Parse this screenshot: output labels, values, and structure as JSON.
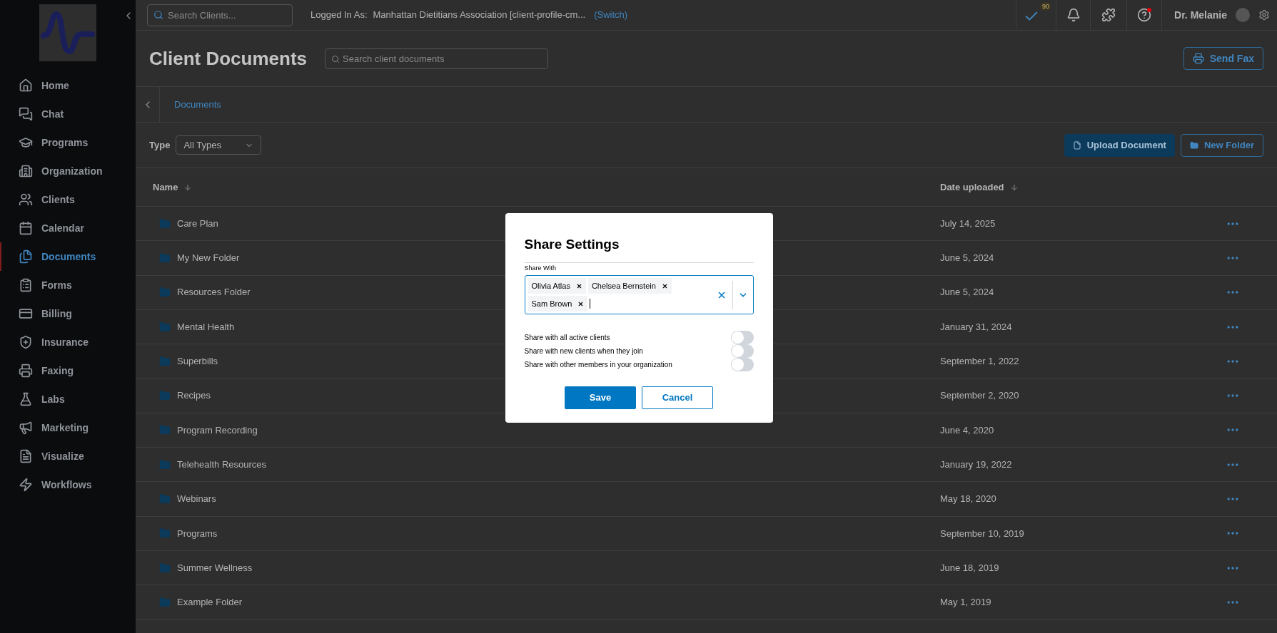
{
  "topbar": {
    "search": {
      "placeholder": "Search Clients..."
    },
    "logged_in_label": "Logged In As:",
    "account": "Manhattan Dietitians Association [client-profile-cm...",
    "switch_link": "(Switch)",
    "tasks_badge": "90",
    "help_has_alert": true,
    "user_name": "Dr. Melanie"
  },
  "sidebar": {
    "items": [
      {
        "label": "Home",
        "selected": false
      },
      {
        "label": "Chat",
        "selected": false
      },
      {
        "label": "Programs",
        "selected": false
      },
      {
        "label": "Organization",
        "selected": false
      },
      {
        "label": "Clients",
        "selected": false
      },
      {
        "label": "Calendar",
        "selected": false
      },
      {
        "label": "Documents",
        "selected": true
      },
      {
        "label": "Forms",
        "selected": false
      },
      {
        "label": "Billing",
        "selected": false
      },
      {
        "label": "Insurance",
        "selected": false
      },
      {
        "label": "Faxing",
        "selected": false
      },
      {
        "label": "Labs",
        "selected": false
      },
      {
        "label": "Marketing",
        "selected": false
      },
      {
        "label": "Visualize",
        "selected": false
      },
      {
        "label": "Workflows",
        "selected": false
      }
    ]
  },
  "page": {
    "title": "Client Documents",
    "search": {
      "placeholder": "Search client documents"
    },
    "send_fax": "Send Fax",
    "breadcrumb": "Documents",
    "type_label": "Type",
    "type_value": "All Types",
    "upload_button": "Upload Document",
    "new_folder_button": "New Folder"
  },
  "table": {
    "columns": [
      "Name",
      "Date uploaded"
    ],
    "rows": [
      {
        "name": "Care Plan",
        "date": "July 14, 2025"
      },
      {
        "name": "My New Folder",
        "date": "June 5, 2024"
      },
      {
        "name": "Resources Folder",
        "date": "June 5, 2024"
      },
      {
        "name": "Mental Health",
        "date": "January 31, 2024"
      },
      {
        "name": "Superbills",
        "date": "September 1, 2022"
      },
      {
        "name": "Recipes",
        "date": "September 2, 2020"
      },
      {
        "name": "Program Recording",
        "date": "June 4, 2020"
      },
      {
        "name": "Telehealth Resources",
        "date": "January 19, 2022"
      },
      {
        "name": "Webinars",
        "date": "May 18, 2020"
      },
      {
        "name": "Programs",
        "date": "September 10, 2019"
      },
      {
        "name": "Summer Wellness",
        "date": "June 18, 2019"
      },
      {
        "name": "Example Folder",
        "date": "May 1, 2019"
      }
    ]
  },
  "dialog": {
    "title": "Share Settings",
    "share_with_label": "Share With",
    "chips": [
      "Olivia Atlas",
      "Chelsea Bernstein",
      "Sam Brown"
    ],
    "toggles": [
      {
        "label": "Share with all active clients",
        "on": false
      },
      {
        "label": "Share with new clients when they join",
        "on": false
      },
      {
        "label": "Share with other members in your organization",
        "on": false
      }
    ],
    "save": "Save",
    "cancel": "Cancel"
  }
}
